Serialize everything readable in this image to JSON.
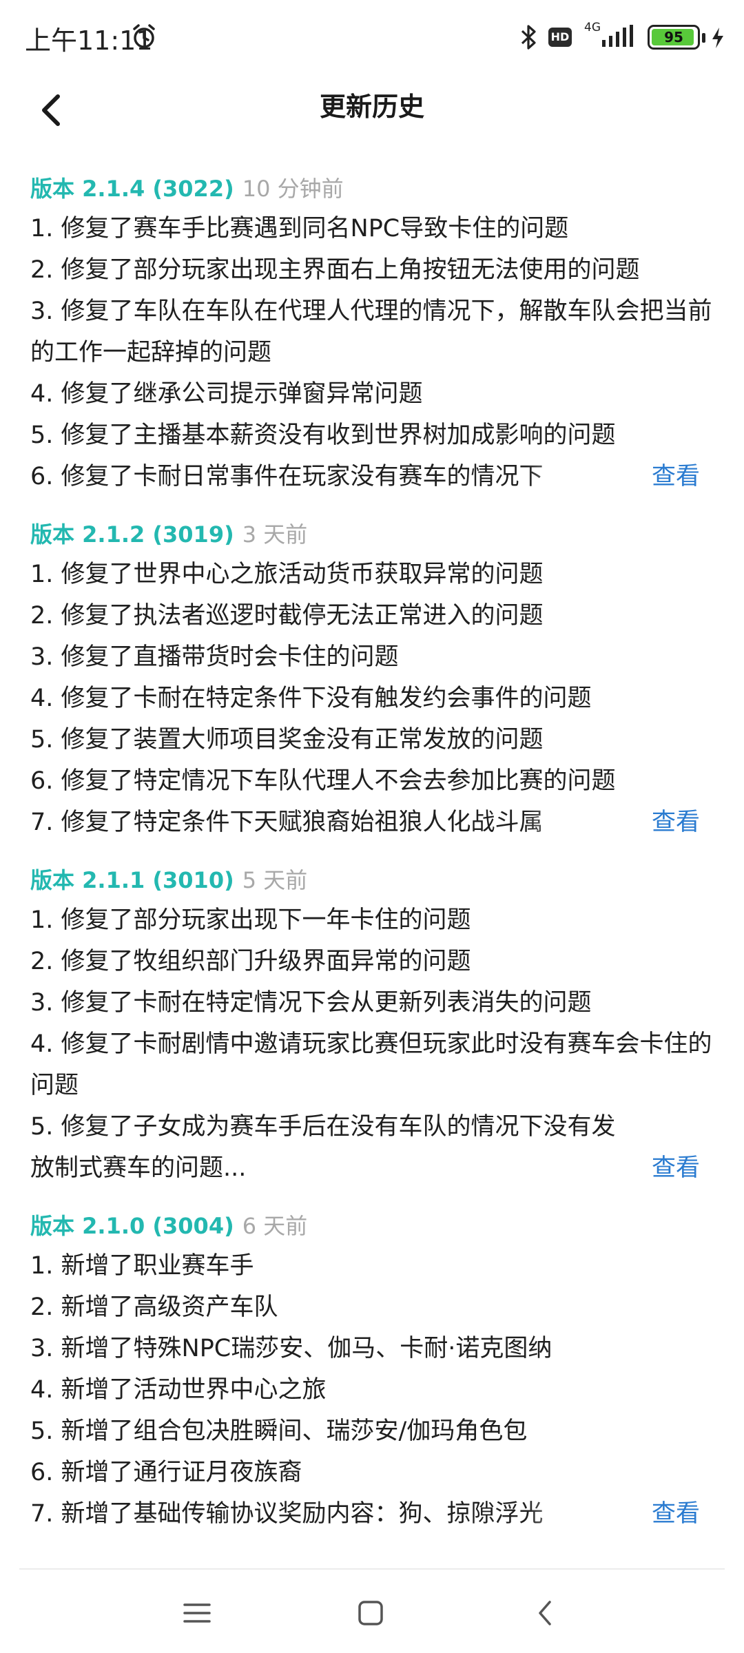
{
  "status": {
    "time": "上午11:11",
    "network": "4G",
    "battery": "95",
    "battery_level": 0.95,
    "hd_label": "HD"
  },
  "header": {
    "title": "更新历史"
  },
  "view_label": "查看",
  "releases": [
    {
      "version": "版本 2.1.4 (3022)",
      "time_ago": "10 分钟前",
      "items": [
        "1. 修复了赛车手比赛遇到同名NPC导致卡住的问题",
        "2. 修复了部分玩家出现主界面右上角按钮无法使用的问题",
        "3. 修复了车队在车队在代理人代理的情况下，解散车队会把当前的工作一起辞掉的问题",
        "4. 修复了继承公司提示弹窗异常问题",
        "5. 修复了主播基本薪资没有收到世界树加成影响的问题",
        "6. 修复了卡耐日常事件在玩家没有赛车的情况下"
      ]
    },
    {
      "version": "版本 2.1.2 (3019)",
      "time_ago": "3 天前",
      "items": [
        "1. 修复了世界中心之旅活动货币获取异常的问题",
        "2. 修复了执法者巡逻时截停无法正常进入的问题",
        "3. 修复了直播带货时会卡住的问题",
        "4. 修复了卡耐在特定条件下没有触发约会事件的问题",
        "5. 修复了装置大师项目奖金没有正常发放的问题",
        "6. 修复了特定情况下车队代理人不会去参加比赛的问题",
        "7. 修复了特定条件下天赋狼裔始祖狼人化战斗属"
      ]
    },
    {
      "version": "版本 2.1.1 (3010)",
      "time_ago": "5 天前",
      "items": [
        "1. 修复了部分玩家出现下一年卡住的问题",
        "2. 修复了牧组织部门升级界面异常的问题",
        "3. 修复了卡耐在特定情况下会从更新列表消失的问题",
        "4. 修复了卡耐剧情中邀请玩家比赛但玩家此时没有赛车会卡住的问题",
        "5. 修复了子女成为赛车手后在没有车队的情况下没有发放制式赛车的问题..."
      ]
    },
    {
      "version": "版本 2.1.0 (3004)",
      "time_ago": "6 天前",
      "items": [
        "1. 新增了职业赛车手",
        "2. 新增了高级资产车队",
        "3. 新增了特殊NPC瑞莎安、伽马、卡耐·诺克图纳",
        "4. 新增了活动世界中心之旅",
        "5. 新增了组合包决胜瞬间、瑞莎安/伽玛角色包",
        "6. 新增了通行证月夜族裔",
        "7. 新增了基础传输协议奖励内容：狗、掠隙浮光"
      ]
    }
  ]
}
